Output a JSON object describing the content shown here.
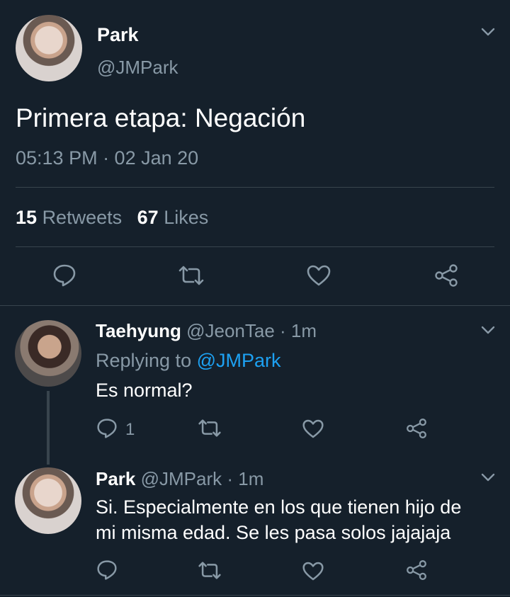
{
  "colors": {
    "background": "#15202b",
    "text": "#ffffff",
    "muted": "#8899a6",
    "link": "#1da1f2",
    "divider": "#38444d"
  },
  "main_tweet": {
    "name": "Park",
    "handle": "@JMPark",
    "text": "Primera etapa: Negación",
    "timestamp": "05:13 PM · 02 Jan 20",
    "retweets_count": "15",
    "retweets_label": "Retweets",
    "likes_count": "67",
    "likes_label": "Likes",
    "actions": [
      "reply-icon",
      "retweet-icon",
      "like-icon",
      "share-icon"
    ]
  },
  "replies": [
    {
      "name": "Taehyung",
      "handle": "@JeonTae",
      "time": "· 1m",
      "replying_prefix": "Replying to",
      "replying_to": "@JMPark",
      "text": "Es normal?",
      "reply_count": "1"
    },
    {
      "name": "Park",
      "handle": "@JMPark",
      "time": "· 1m",
      "text_line1": "Si. Especialmente en los que tienen hijo de",
      "text_line2": "mi misma edad. Se les pasa solos jajajaja",
      "reply_count": ""
    }
  ]
}
